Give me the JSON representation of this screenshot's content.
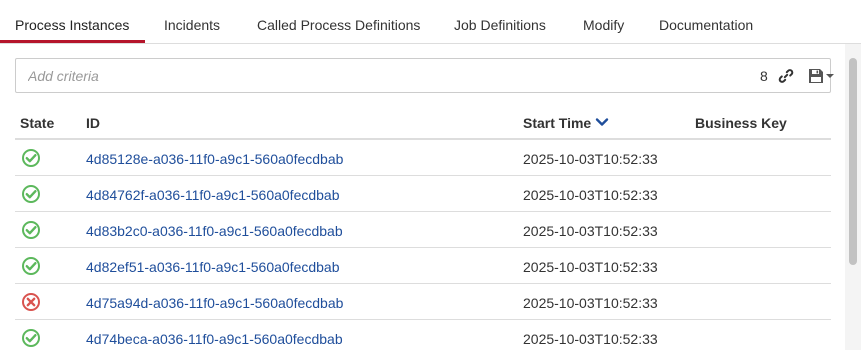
{
  "tabs": [
    {
      "label": "Process Instances",
      "active": true
    },
    {
      "label": "Incidents",
      "active": false
    },
    {
      "label": "Called Process Definitions",
      "active": false
    },
    {
      "label": "Job Definitions",
      "active": false
    },
    {
      "label": "Modify",
      "active": false
    },
    {
      "label": "Documentation",
      "active": false
    }
  ],
  "search": {
    "placeholder": "Add criteria",
    "value": "",
    "result_count": "8",
    "link_icon": "link-icon",
    "save_icon": "floppy-disk-icon"
  },
  "table": {
    "columns": {
      "state": "State",
      "id": "ID",
      "start_time": "Start Time",
      "business_key": "Business Key"
    },
    "sort": {
      "column": "start_time",
      "direction": "descending",
      "icon": "chevron-down-icon"
    },
    "rows": [
      {
        "state": "ok",
        "id": "4d85128e-a036-11f0-a9c1-560a0fecdbab",
        "start_time": "2025-10-03T10:52:33",
        "business_key": ""
      },
      {
        "state": "ok",
        "id": "4d84762f-a036-11f0-a9c1-560a0fecdbab",
        "start_time": "2025-10-03T10:52:33",
        "business_key": ""
      },
      {
        "state": "ok",
        "id": "4d83b2c0-a036-11f0-a9c1-560a0fecdbab",
        "start_time": "2025-10-03T10:52:33",
        "business_key": ""
      },
      {
        "state": "ok",
        "id": "4d82ef51-a036-11f0-a9c1-560a0fecdbab",
        "start_time": "2025-10-03T10:52:33",
        "business_key": ""
      },
      {
        "state": "failed",
        "id": "4d75a94d-a036-11f0-a9c1-560a0fecdbab",
        "start_time": "2025-10-03T10:52:33",
        "business_key": ""
      },
      {
        "state": "ok",
        "id": "4d74beca-a036-11f0-a9c1-560a0fecdbab",
        "start_time": "2025-10-03T10:52:33",
        "business_key": ""
      }
    ]
  },
  "colors": {
    "accent": "#b5152b",
    "link": "#1f4e9b",
    "ok": "#5cb85c",
    "failed": "#d9534f"
  }
}
